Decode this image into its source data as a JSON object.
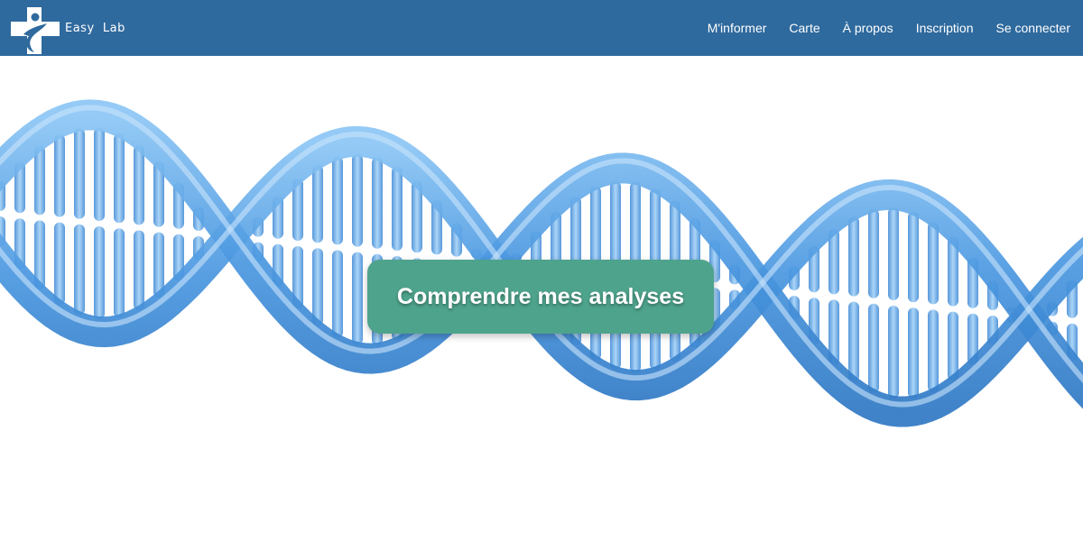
{
  "header": {
    "brand": "Easy  Lab",
    "logo_icon": "medical-cross-person-icon",
    "nav": [
      {
        "label": "M'informer"
      },
      {
        "label": "Carte"
      },
      {
        "label": "À propos"
      },
      {
        "label": "Inscription"
      },
      {
        "label": "Se connecter"
      }
    ]
  },
  "hero": {
    "background_image": "dna-double-helix",
    "cta_label": "Comprendre mes analyses"
  },
  "colors": {
    "navbar": "#2f6a9e",
    "cta": "#4ea38c",
    "dna": "#4a97e0"
  }
}
